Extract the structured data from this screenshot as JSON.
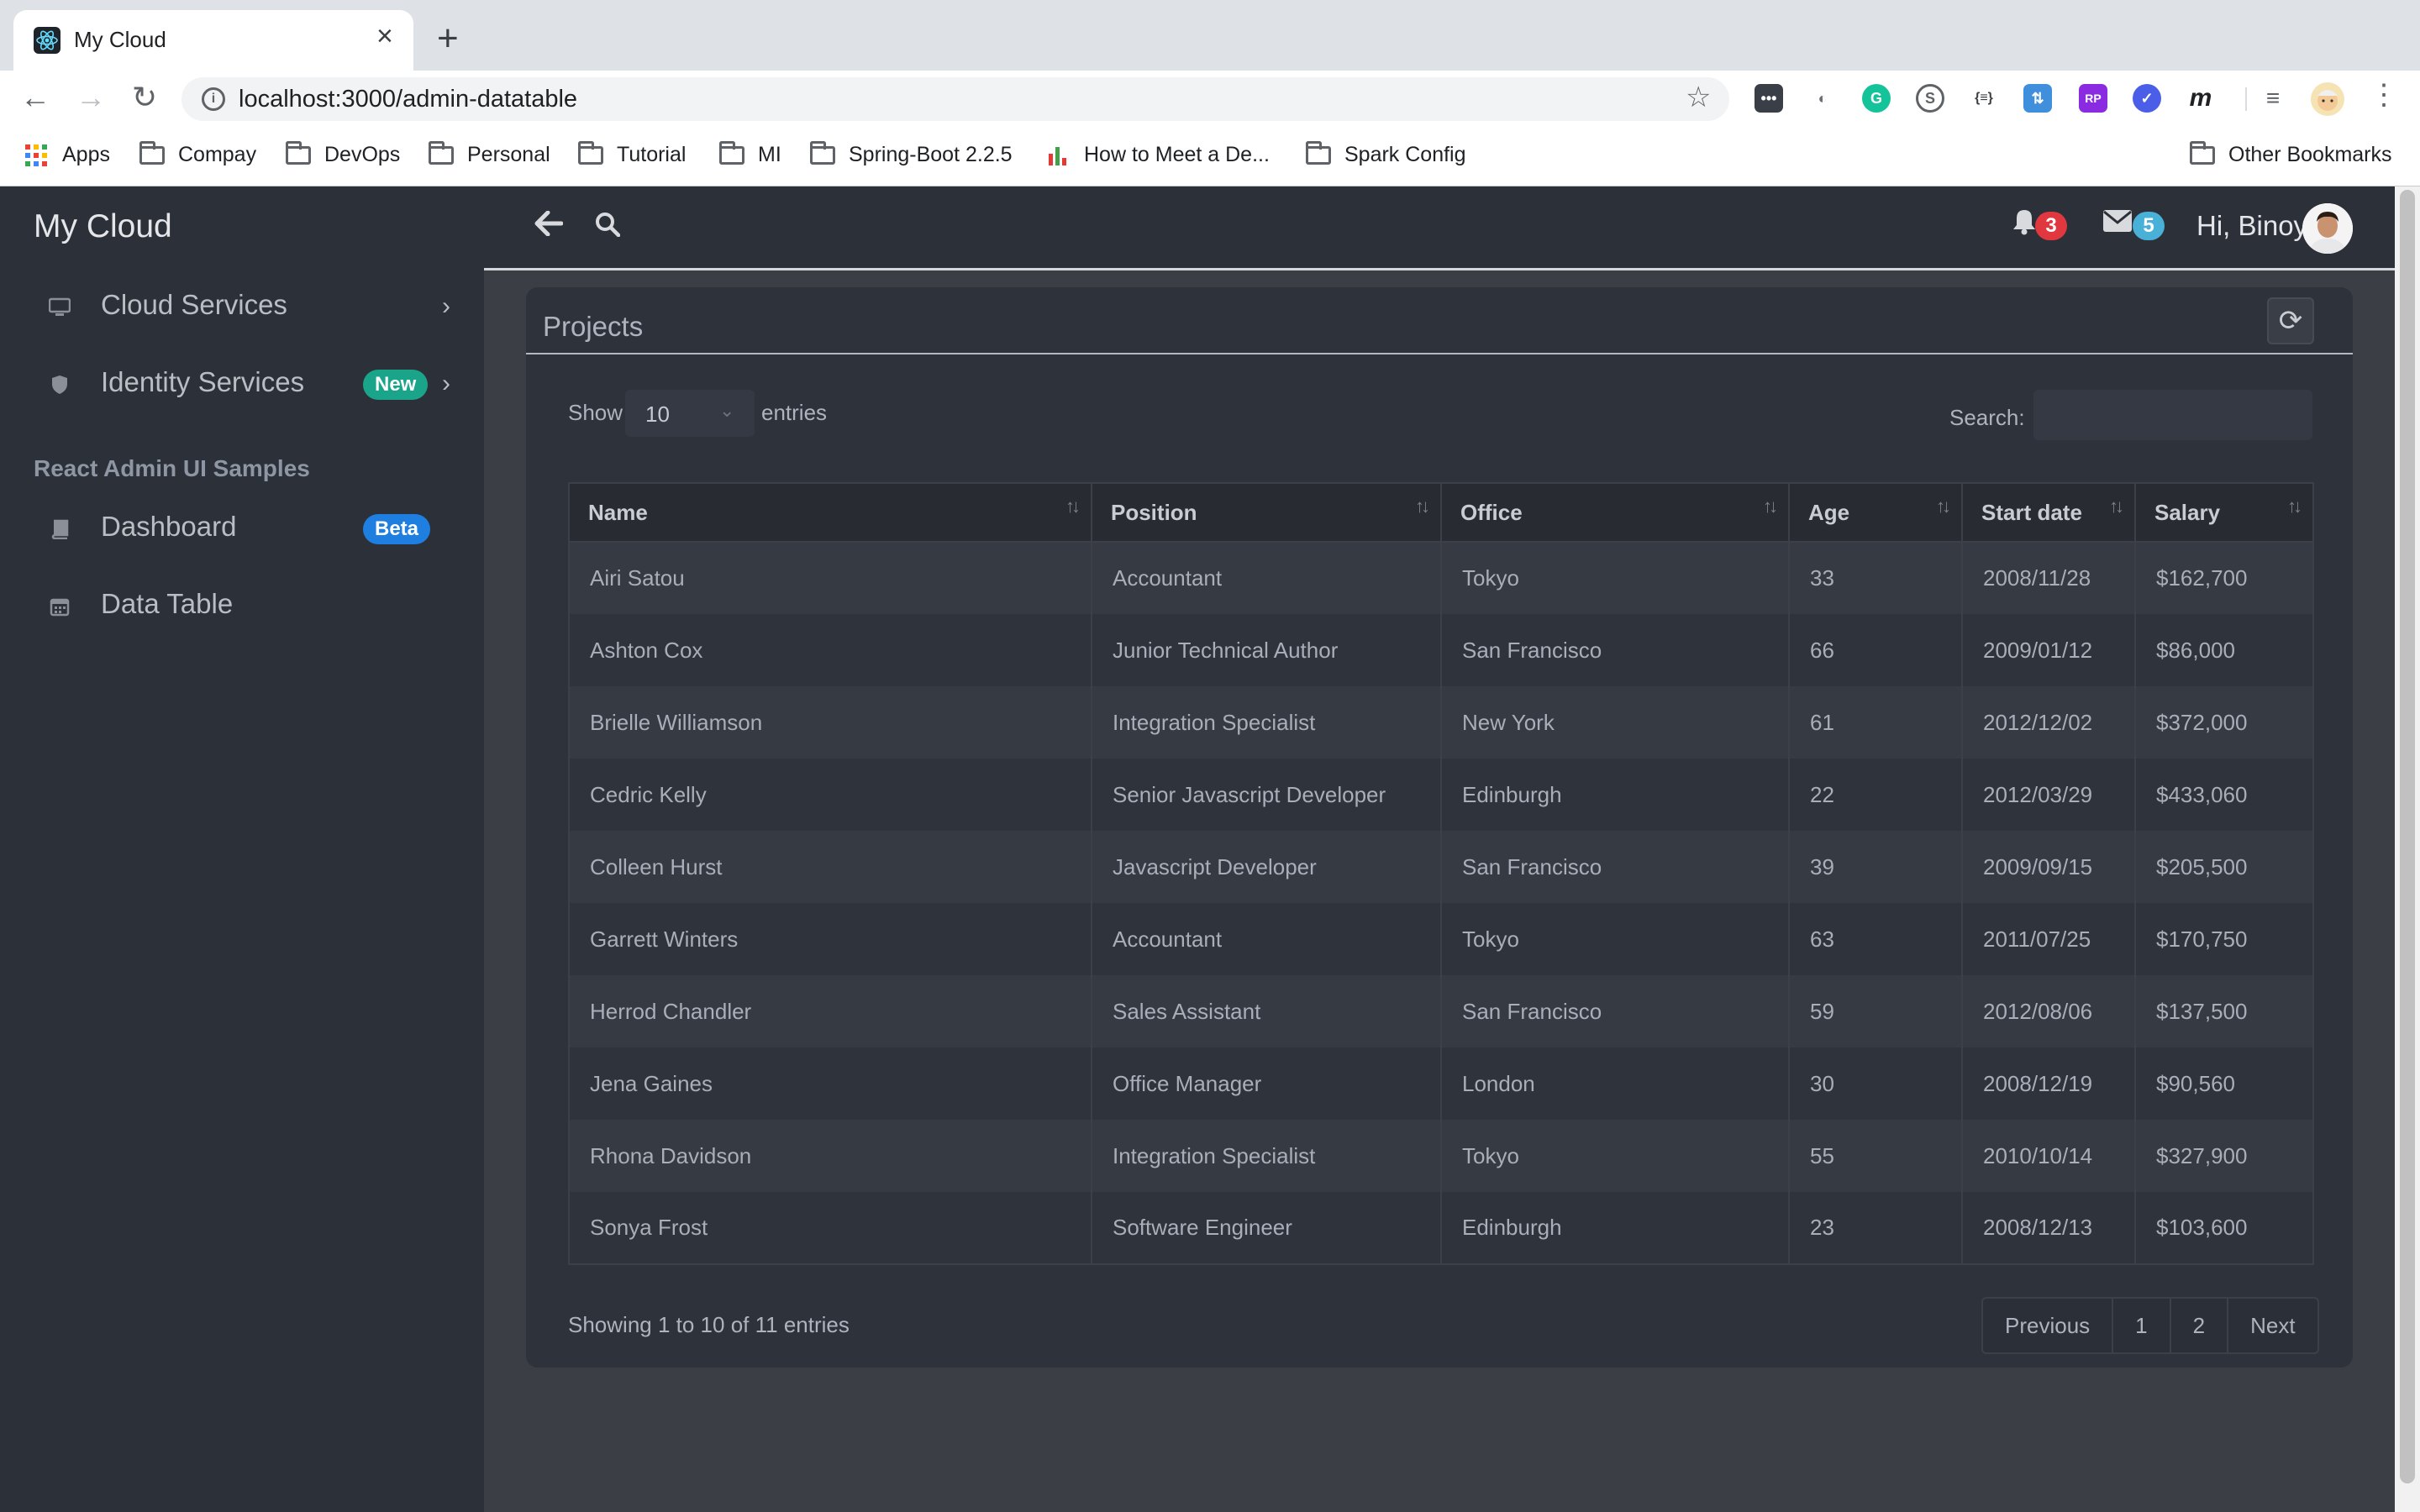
{
  "browser": {
    "tab_title": "My Cloud",
    "tab_close": "×",
    "new_tab": "+",
    "back": "←",
    "forward": "→",
    "reload": "↻",
    "url": "localhost:3000/admin-datatable",
    "bookmarks": [
      {
        "label": "Apps"
      },
      {
        "label": "Compay"
      },
      {
        "label": "DevOps"
      },
      {
        "label": "Personal"
      },
      {
        "label": "Tutorial"
      },
      {
        "label": "MI"
      },
      {
        "label": "Spring-Boot 2.2.5"
      },
      {
        "label": "How to Meet a De..."
      },
      {
        "label": "Spark Config"
      }
    ],
    "other_bookmarks": "Other Bookmarks",
    "extensions": [
      "•••",
      "◐",
      "G",
      "S",
      "{≡}",
      "⇅",
      "RP",
      "✓",
      "m",
      "≡"
    ]
  },
  "sidebar": {
    "brand": "My Cloud",
    "items": [
      {
        "label": "Cloud Services",
        "icon": "monitor-icon"
      },
      {
        "label": "Identity Services",
        "icon": "shield-icon",
        "badge": "New"
      }
    ],
    "section_title": "React Admin UI Samples",
    "samples": [
      {
        "label": "Dashboard",
        "icon": "book-icon",
        "badge": "Beta"
      },
      {
        "label": "Data Table",
        "icon": "calendar-icon"
      }
    ],
    "chevron": "›"
  },
  "header": {
    "back_icon": "🡐",
    "notifications_count": "3",
    "messages_count": "5",
    "greeting": "Hi, Binoy"
  },
  "card": {
    "title": "Projects",
    "refresh": "⟳",
    "show_label": "Show",
    "entries_value": "10",
    "entries_label": "entries",
    "search_label": "Search:",
    "search_value": "",
    "columns": [
      "Name",
      "Position",
      "Office",
      "Age",
      "Start date",
      "Salary"
    ],
    "rows": [
      [
        "Airi Satou",
        "Accountant",
        "Tokyo",
        "33",
        "2008/11/28",
        "$162,700"
      ],
      [
        "Ashton Cox",
        "Junior Technical Author",
        "San Francisco",
        "66",
        "2009/01/12",
        "$86,000"
      ],
      [
        "Brielle Williamson",
        "Integration Specialist",
        "New York",
        "61",
        "2012/12/02",
        "$372,000"
      ],
      [
        "Cedric Kelly",
        "Senior Javascript Developer",
        "Edinburgh",
        "22",
        "2012/03/29",
        "$433,060"
      ],
      [
        "Colleen Hurst",
        "Javascript Developer",
        "San Francisco",
        "39",
        "2009/09/15",
        "$205,500"
      ],
      [
        "Garrett Winters",
        "Accountant",
        "Tokyo",
        "63",
        "2011/07/25",
        "$170,750"
      ],
      [
        "Herrod Chandler",
        "Sales Assistant",
        "San Francisco",
        "59",
        "2012/08/06",
        "$137,500"
      ],
      [
        "Jena Gaines",
        "Office Manager",
        "London",
        "30",
        "2008/12/19",
        "$90,560"
      ],
      [
        "Rhona Davidson",
        "Integration Specialist",
        "Tokyo",
        "55",
        "2010/10/14",
        "$327,900"
      ],
      [
        "Sonya Frost",
        "Software Engineer",
        "Edinburgh",
        "23",
        "2008/12/13",
        "$103,600"
      ]
    ],
    "info": "Showing 1 to 10 of 11 entries",
    "pagination": [
      "Previous",
      "1",
      "2",
      "Next"
    ]
  },
  "colors": {
    "badge_new": "#1aa58a",
    "badge_beta": "#1f7fe0",
    "notif_badge": "#e0383e",
    "mail_badge": "#49b0d8"
  }
}
